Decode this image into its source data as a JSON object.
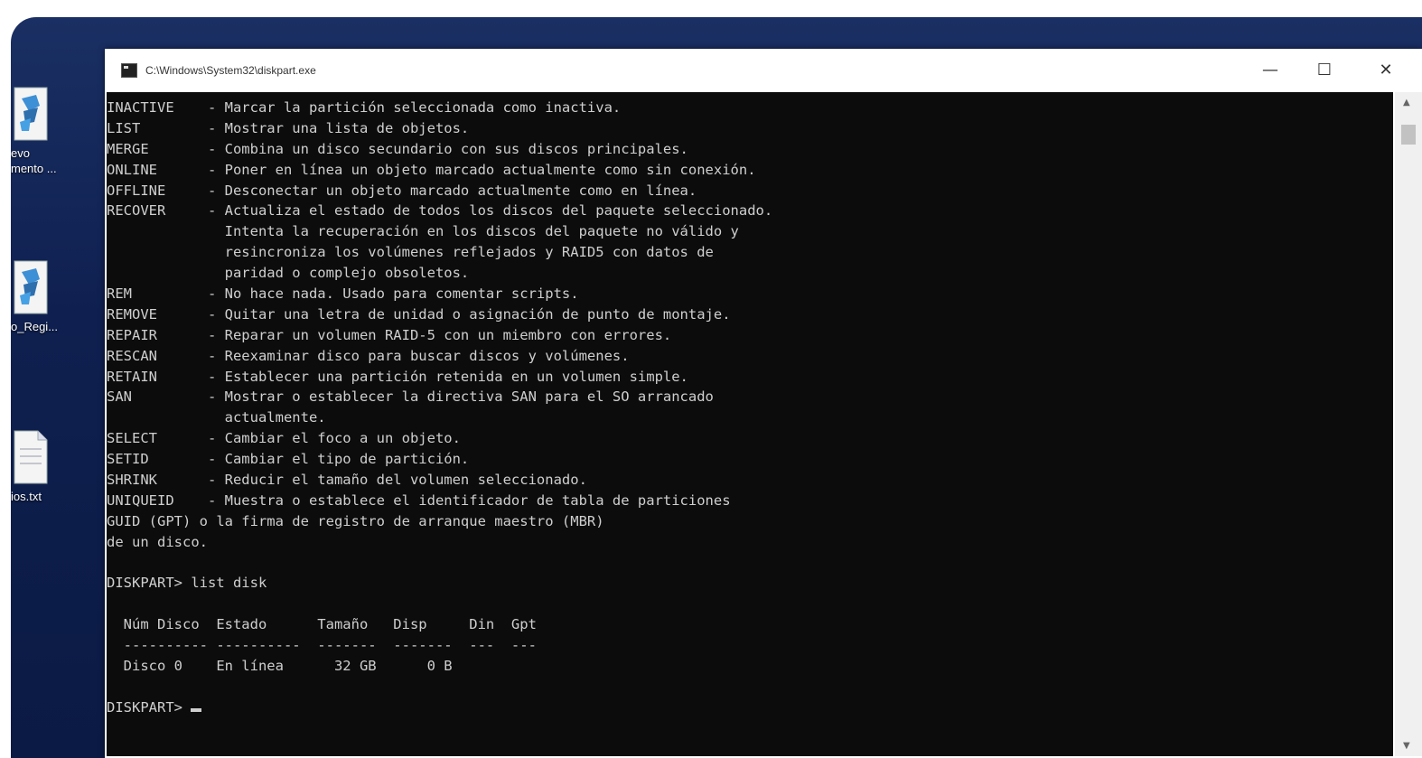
{
  "desktop": {
    "icons": [
      {
        "label": "evo\nmento ..."
      },
      {
        "label": "o_Regi..."
      },
      {
        "label": "ios.txt"
      }
    ]
  },
  "window": {
    "title": "C:\\Windows\\System32\\diskpart.exe",
    "minimize_glyph": "—",
    "maximize_glyph": "☐",
    "close_glyph": "✕"
  },
  "console": {
    "lines": [
      "INACTIVE    - Marcar la partición seleccionada como inactiva.",
      "LIST        - Mostrar una lista de objetos.",
      "MERGE       - Combina un disco secundario con sus discos principales.",
      "ONLINE      - Poner en línea un objeto marcado actualmente como sin conexión.",
      "OFFLINE     - Desconectar un objeto marcado actualmente como en línea.",
      "RECOVER     - Actualiza el estado de todos los discos del paquete seleccionado.",
      "              Intenta la recuperación en los discos del paquete no válido y",
      "              resincroniza los volúmenes reflejados y RAID5 con datos de",
      "              paridad o complejo obsoletos.",
      "REM         - No hace nada. Usado para comentar scripts.",
      "REMOVE      - Quitar una letra de unidad o asignación de punto de montaje.",
      "REPAIR      - Reparar un volumen RAID-5 con un miembro con errores.",
      "RESCAN      - Reexaminar disco para buscar discos y volúmenes.",
      "RETAIN      - Establecer una partición retenida en un volumen simple.",
      "SAN         - Mostrar o establecer la directiva SAN para el SO arrancado",
      "              actualmente.",
      "SELECT      - Cambiar el foco a un objeto.",
      "SETID       - Cambiar el tipo de partición.",
      "SHRINK      - Reducir el tamaño del volumen seleccionado.",
      "UNIQUEID    - Muestra o establece el identificador de tabla de particiones",
      "GUID (GPT) o la firma de registro de arranque maestro (MBR)",
      "de un disco.",
      "",
      "DISKPART> list disk",
      "",
      "  Núm Disco  Estado      Tamaño   Disp     Din  Gpt",
      "  ---------- ----------  -------  -------  ---  ---",
      "  Disco 0    En línea      32 GB      0 B",
      "",
      "DISKPART> "
    ]
  }
}
